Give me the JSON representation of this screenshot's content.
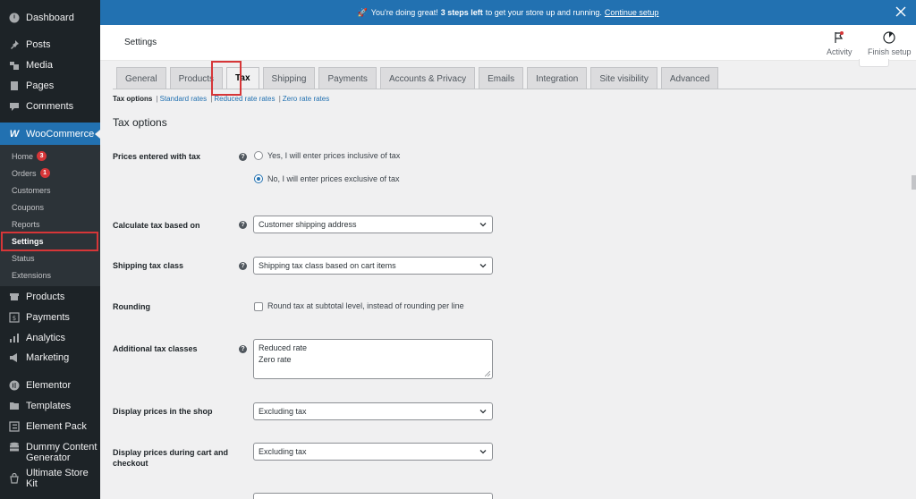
{
  "sidebar": {
    "menu_top": [
      {
        "name": "dashboard",
        "label": "Dashboard",
        "icon": "dashboard-icon"
      },
      {
        "name": "posts",
        "label": "Posts",
        "icon": "pin-icon"
      },
      {
        "name": "media",
        "label": "Media",
        "icon": "media-icon"
      },
      {
        "name": "pages",
        "label": "Pages",
        "icon": "page-icon"
      },
      {
        "name": "comments",
        "label": "Comments",
        "icon": "comment-icon"
      }
    ],
    "woocommerce": {
      "label": "WooCommerce",
      "icon_glyph": "W"
    },
    "submenu": [
      {
        "label": "Home",
        "badge": "3"
      },
      {
        "label": "Orders",
        "badge": "1"
      },
      {
        "label": "Customers"
      },
      {
        "label": "Coupons"
      },
      {
        "label": "Reports"
      },
      {
        "label": "Settings"
      },
      {
        "label": "Status"
      },
      {
        "label": "Extensions"
      }
    ],
    "menu_bottom": [
      {
        "label": "Products"
      },
      {
        "label": "Payments"
      },
      {
        "label": "Analytics"
      },
      {
        "label": "Marketing"
      },
      {
        "label": "Elementor"
      },
      {
        "label": "Templates"
      },
      {
        "label": "Element Pack"
      },
      {
        "label": "Dummy Content Generator"
      },
      {
        "label": "Ultimate Store Kit"
      }
    ]
  },
  "notice": {
    "text_before": "You're doing great!",
    "bold": "3 steps left",
    "text_after": "to get your store up and running.",
    "link": "Continue setup"
  },
  "header": {
    "title": "Settings",
    "activity_label": "Activity",
    "finish_setup_label": "Finish setup"
  },
  "tabs": [
    "General",
    "Products",
    "Tax",
    "Shipping",
    "Payments",
    "Accounts & Privacy",
    "Emails",
    "Integration",
    "Site visibility",
    "Advanced"
  ],
  "active_tab": "Tax",
  "subtabs": {
    "current": "Tax options",
    "links": [
      "Standard rates",
      "Reduced rate rates",
      "Zero rate rates"
    ]
  },
  "section_title": "Tax options",
  "form": {
    "prices_entered": {
      "label": "Prices entered with tax",
      "options": [
        "Yes, I will enter prices inclusive of tax",
        "No, I will enter prices exclusive of tax"
      ],
      "selected_index": 1
    },
    "calc_based_on": {
      "label": "Calculate tax based on",
      "value": "Customer shipping address"
    },
    "shipping_tax_class": {
      "label": "Shipping tax class",
      "value": "Shipping tax class based on cart items"
    },
    "rounding": {
      "label": "Rounding",
      "checkbox_label": "Round tax at subtotal level, instead of rounding per line",
      "checked": false
    },
    "additional_classes": {
      "label": "Additional tax classes",
      "lines": [
        "Reduced rate",
        "Zero rate"
      ]
    },
    "display_shop": {
      "label": "Display prices in the shop",
      "value": "Excluding tax"
    },
    "display_cart": {
      "label": "Display prices during cart and checkout",
      "value": "Excluding tax"
    }
  },
  "colors": {
    "sidebar_bg": "#1d2327",
    "submenu_bg": "#2c3338",
    "accent": "#2271b1",
    "badge": "#d63638",
    "highlight": "#d63638"
  }
}
